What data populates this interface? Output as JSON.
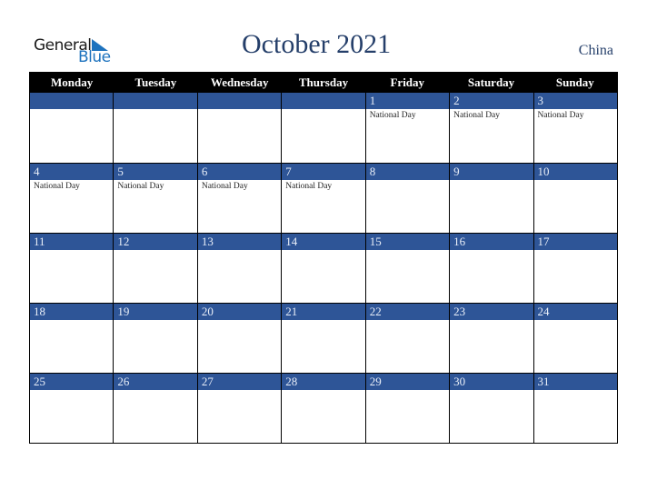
{
  "logo": {
    "general": "General",
    "blue": "Blue",
    "icon": "triangle-logo-icon"
  },
  "title": "October 2021",
  "country": "China",
  "weekdays": [
    "Monday",
    "Tuesday",
    "Wednesday",
    "Thursday",
    "Friday",
    "Saturday",
    "Sunday"
  ],
  "weeks": [
    [
      {
        "day": "",
        "event": ""
      },
      {
        "day": "",
        "event": ""
      },
      {
        "day": "",
        "event": ""
      },
      {
        "day": "",
        "event": ""
      },
      {
        "day": "1",
        "event": "National Day"
      },
      {
        "day": "2",
        "event": "National Day"
      },
      {
        "day": "3",
        "event": "National Day"
      }
    ],
    [
      {
        "day": "4",
        "event": "National Day"
      },
      {
        "day": "5",
        "event": "National Day"
      },
      {
        "day": "6",
        "event": "National Day"
      },
      {
        "day": "7",
        "event": "National Day"
      },
      {
        "day": "8",
        "event": ""
      },
      {
        "day": "9",
        "event": ""
      },
      {
        "day": "10",
        "event": ""
      }
    ],
    [
      {
        "day": "11",
        "event": ""
      },
      {
        "day": "12",
        "event": ""
      },
      {
        "day": "13",
        "event": ""
      },
      {
        "day": "14",
        "event": ""
      },
      {
        "day": "15",
        "event": ""
      },
      {
        "day": "16",
        "event": ""
      },
      {
        "day": "17",
        "event": ""
      }
    ],
    [
      {
        "day": "18",
        "event": ""
      },
      {
        "day": "19",
        "event": ""
      },
      {
        "day": "20",
        "event": ""
      },
      {
        "day": "21",
        "event": ""
      },
      {
        "day": "22",
        "event": ""
      },
      {
        "day": "23",
        "event": ""
      },
      {
        "day": "24",
        "event": ""
      }
    ],
    [
      {
        "day": "25",
        "event": ""
      },
      {
        "day": "26",
        "event": ""
      },
      {
        "day": "27",
        "event": ""
      },
      {
        "day": "28",
        "event": ""
      },
      {
        "day": "29",
        "event": ""
      },
      {
        "day": "30",
        "event": ""
      },
      {
        "day": "31",
        "event": ""
      }
    ]
  ],
  "colors": {
    "header_bg": "#000000",
    "date_strip": "#2e5597",
    "title": "#253f6a",
    "logo_blue": "#1e73be"
  }
}
